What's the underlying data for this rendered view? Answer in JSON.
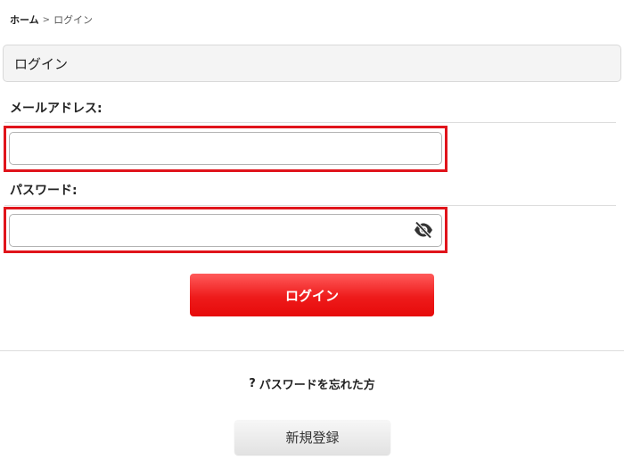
{
  "breadcrumb": {
    "home": "ホーム",
    "separator": ">",
    "current": "ログイン"
  },
  "page_title": "ログイン",
  "email": {
    "label": "メールアドレス:",
    "value": "",
    "placeholder": ""
  },
  "password": {
    "label": "パスワード:",
    "value": "",
    "placeholder": "",
    "toggle_icon": "eye-slash-icon"
  },
  "login_button": {
    "label": "ログイン",
    "color": "#ee1b1b"
  },
  "forgot_password": {
    "icon": "?",
    "label": "パスワードを忘れた方"
  },
  "register_button": {
    "label": "新規登録"
  },
  "highlight_color": "#e0141b"
}
